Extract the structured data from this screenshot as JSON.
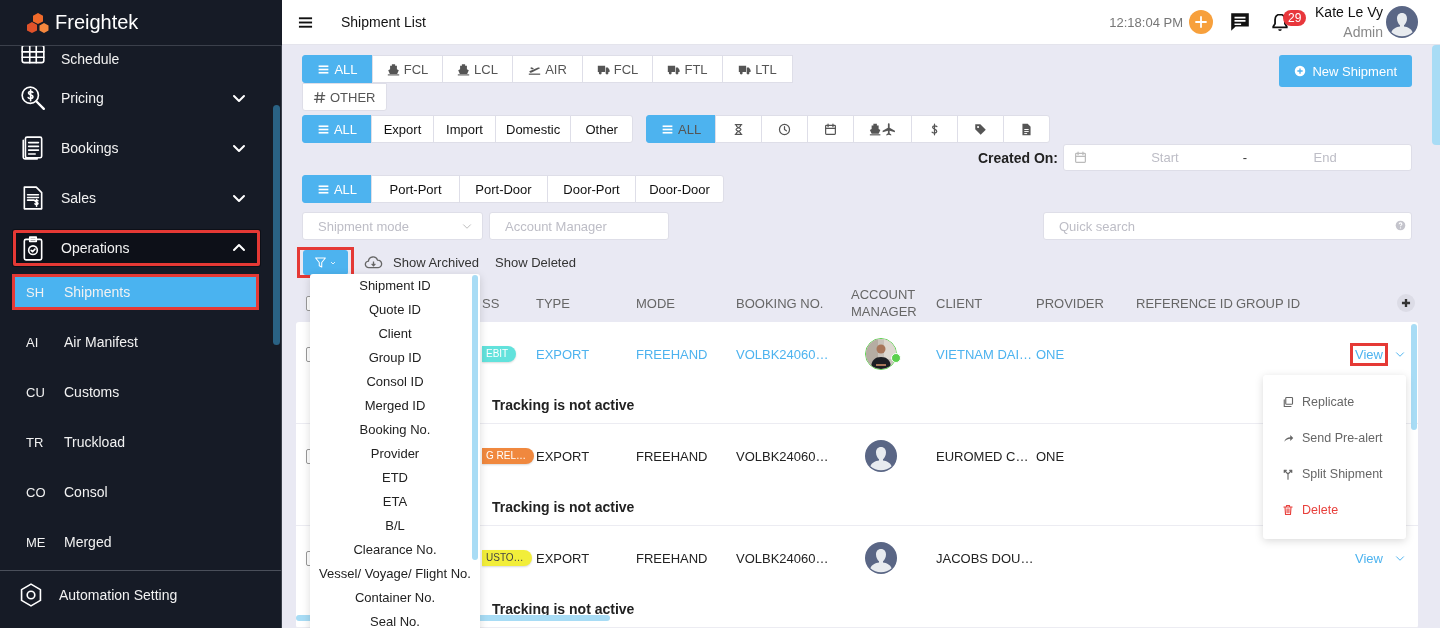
{
  "sidebar": {
    "logo": "Freightek",
    "items": [
      {
        "label": "Schedule",
        "kind": "grid",
        "highlighted": false
      },
      {
        "label": "Pricing",
        "kind": "search-dollar",
        "expanded": false,
        "highlighted": false
      },
      {
        "label": "Bookings",
        "kind": "documents",
        "expanded": false,
        "highlighted": false
      },
      {
        "label": "Sales",
        "kind": "receipt",
        "expanded": false,
        "highlighted": false
      },
      {
        "label": "Operations",
        "kind": "clipboard",
        "expanded": true,
        "highlighted": true,
        "children": [
          {
            "code": "SH",
            "label": "Shipments",
            "selected": true,
            "highlighted": true
          },
          {
            "code": "AI",
            "label": "Air Manifest",
            "selected": false,
            "highlighted": false
          },
          {
            "code": "CU",
            "label": "Customs",
            "selected": false,
            "highlighted": false
          },
          {
            "code": "TR",
            "label": "Truckload",
            "selected": false,
            "highlighted": false
          },
          {
            "code": "CO",
            "label": "Consol",
            "selected": false,
            "highlighted": false
          },
          {
            "code": "ME",
            "label": "Merged",
            "selected": false,
            "highlighted": false
          }
        ]
      }
    ],
    "footer_item": {
      "label": "Automation Setting",
      "kind": "hexagon"
    }
  },
  "header": {
    "title": "Shipment List",
    "time": "12:18:04 PM",
    "notifications": "29",
    "user_name": "Kate Le Vy",
    "user_role": "Admin"
  },
  "mode_tabs": [
    {
      "label": "ALL",
      "kind": "list",
      "selected": true
    },
    {
      "label": "FCL",
      "kind": "ship",
      "selected": false
    },
    {
      "label": "LCL",
      "kind": "ship",
      "selected": false
    },
    {
      "label": "AIR",
      "kind": "plane",
      "selected": false
    },
    {
      "label": "FCL",
      "kind": "truck",
      "selected": false
    },
    {
      "label": "FTL",
      "kind": "truck",
      "selected": false
    },
    {
      "label": "LTL",
      "kind": "truck",
      "selected": false
    },
    {
      "label": "OTHER",
      "kind": "hash",
      "selected": false
    }
  ],
  "new_button": "New Shipment",
  "direction_tabs": [
    {
      "label": "ALL",
      "kind": "list",
      "selected": true
    },
    {
      "label": "Export",
      "selected": false
    },
    {
      "label": "Import",
      "selected": false
    },
    {
      "label": "Domestic",
      "selected": false
    },
    {
      "label": "Other",
      "selected": false
    }
  ],
  "status_tabs": [
    {
      "label": "ALL",
      "kind": "list",
      "selected": true
    },
    {
      "kind": "hourglass",
      "selected": false
    },
    {
      "kind": "clock",
      "selected": false
    },
    {
      "kind": "calendar",
      "selected": false
    },
    {
      "kind": "shipplane",
      "selected": false
    },
    {
      "kind": "dollar",
      "selected": false
    },
    {
      "kind": "tag",
      "selected": false
    },
    {
      "kind": "doc",
      "selected": false
    }
  ],
  "created_on": {
    "label": "Created On:",
    "start_placeholder": "Start",
    "separator": "-",
    "end_placeholder": "End"
  },
  "service_tabs": [
    {
      "label": "ALL",
      "kind": "list",
      "selected": true
    },
    {
      "label": "Port-Port",
      "selected": false
    },
    {
      "label": "Port-Door",
      "selected": false
    },
    {
      "label": "Door-Port",
      "selected": false
    },
    {
      "label": "Door-Door",
      "selected": false
    }
  ],
  "filters": {
    "shipment_mode_placeholder": "Shipment mode",
    "account_manager_placeholder": "Account Manager",
    "quick_search_placeholder": "Quick search"
  },
  "toolbar": {
    "filter_highlighted": true,
    "show_archived": "Show Archived",
    "show_deleted": "Show Deleted"
  },
  "table": {
    "header_checked": false,
    "columns": [
      "SS",
      "TYPE",
      "MODE",
      "BOOKING NO.",
      "ACCOUNT MANAGER",
      "CLIENT",
      "PROVIDER",
      "REFERENCE ID",
      "GROUP ID"
    ],
    "rows": [
      {
        "checked": false,
        "status": "EBIT",
        "color": "#62e2dc",
        "type": "EXPORT",
        "mode": "FREEHAND",
        "booking": "VOLBK24060…",
        "online": true,
        "client": "VIETNAM DAI…",
        "provider": "ONE",
        "linked": true,
        "action": "View",
        "action_highlighted": true,
        "tracking": "Tracking is not active"
      },
      {
        "kind": "placeholder",
        "checked": false,
        "status": "G REL…",
        "color": "#f0883e",
        "type": "EXPORT",
        "mode": "FREEHAND",
        "booking": "VOLBK24060…",
        "online": false,
        "client": "EUROMED C…",
        "provider": "ONE",
        "linked": false,
        "tracking": "Tracking is not active"
      },
      {
        "kind": "placeholder",
        "checked": false,
        "status": "USTO…",
        "color": "#f2ee3a",
        "type": "EXPORT",
        "mode": "FREEHAND",
        "booking": "VOLBK24060…",
        "online": false,
        "client": "JACOBS DOU…",
        "linked": false,
        "action": "View",
        "action_highlighted": false,
        "tracking": "Tracking is not active"
      }
    ]
  },
  "row_menu": [
    {
      "label": "Replicate",
      "kind": "copy"
    },
    {
      "label": "Send Pre-alert",
      "kind": "share"
    },
    {
      "label": "Split Shipment",
      "kind": "split"
    },
    {
      "label": "Delete",
      "kind": "danger"
    }
  ],
  "field_menu": [
    "Shipment ID",
    "Quote ID",
    "Client",
    "Group ID",
    "Consol ID",
    "Merged ID",
    "Booking No.",
    "Provider",
    "ETD",
    "ETA",
    "B/L",
    "Clearance No.",
    "Vessel/ Voyage/ Flight No.",
    "Container No.",
    "Seal No."
  ]
}
